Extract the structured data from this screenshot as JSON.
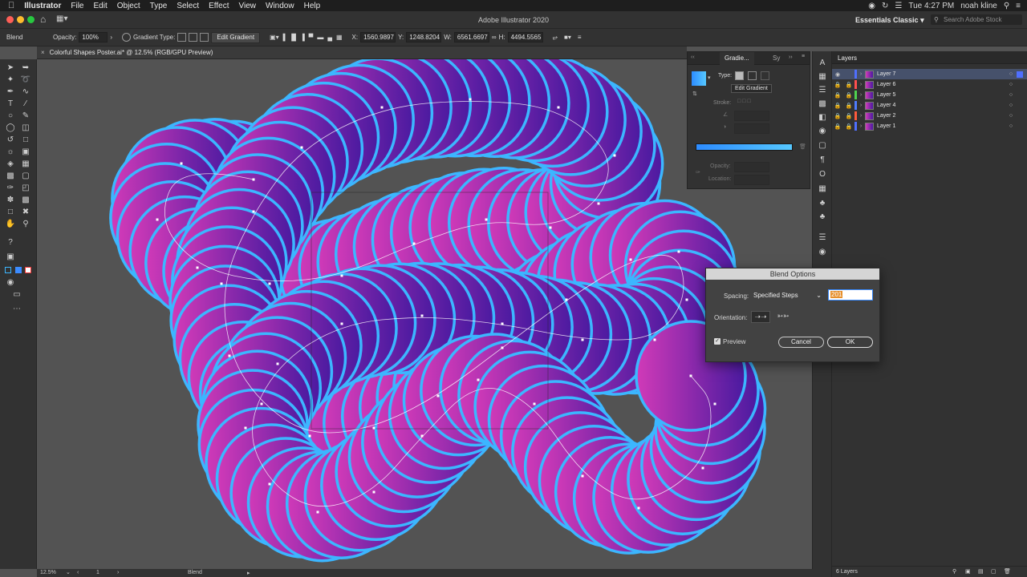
{
  "menu": {
    "app": "Illustrator",
    "items": [
      "File",
      "Edit",
      "Object",
      "Type",
      "Select",
      "Effect",
      "View",
      "Window",
      "Help"
    ],
    "clock": "Tue 4:27 PM",
    "user": "noah kline"
  },
  "titlebar": {
    "title": "Adobe Illustrator 2020",
    "workspace": "Essentials Classic",
    "search_placeholder": "Search Adobe Stock"
  },
  "control": {
    "mode": "Blend",
    "opacity_label": "Opacity:",
    "opacity_value": "100%",
    "gradient_type_label": "Gradient Type:",
    "edit_gradient": "Edit Gradient",
    "x_label": "X:",
    "x_value": "1560.9897",
    "y_label": "Y:",
    "y_value": "1248.8204",
    "w_label": "W:",
    "w_value": "6561.6697",
    "h_label": "H:",
    "h_value": "4494.5565"
  },
  "document": {
    "tab": "Colorful Shapes Poster.ai* @ 12.5% (RGB/GPU Preview)"
  },
  "gradient_panel": {
    "tab1": "Gradie...",
    "tab2": "Sy",
    "type_label": "Type:",
    "tooltip": "Edit Gradient",
    "stroke_label": "Stroke:",
    "opacity_label": "Opacity:",
    "location_label": "Location:"
  },
  "layers": {
    "title": "Layers",
    "items": [
      {
        "name": "Layer 7",
        "color": "#4f6fff"
      },
      {
        "name": "Layer 6",
        "color": "#ff4f4f"
      },
      {
        "name": "Layer 5",
        "color": "#4fd34f"
      },
      {
        "name": "Layer 4",
        "color": "#4f7cff"
      },
      {
        "name": "Layer 2",
        "color": "#ff5a3c"
      },
      {
        "name": "Layer 1",
        "color": "#4f6fff"
      }
    ],
    "count": "6 Layers"
  },
  "blend_dialog": {
    "title": "Blend Options",
    "spacing_label": "Spacing:",
    "spacing_value": "Specified Steps",
    "steps_value": "201",
    "orientation_label": "Orientation:",
    "preview_label": "Preview",
    "cancel": "Cancel",
    "ok": "OK"
  },
  "status": {
    "zoom": "12.5%",
    "artboard": "1",
    "tool": "Blend"
  },
  "colors": {
    "ring": "#3cb6ff",
    "fill_start": "#d13ab8",
    "fill_end": "#4a1aa0",
    "accent": "#2d8cff"
  }
}
